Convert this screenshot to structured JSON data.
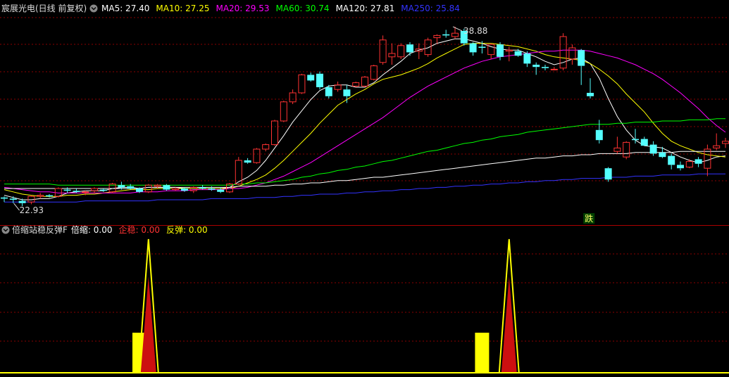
{
  "header": {
    "title": "宸展光电(日线 前复权)",
    "ma_items": [
      {
        "label": "MA5: 27.40",
        "color": "#ffffff"
      },
      {
        "label": "MA10: 27.25",
        "color": "#ffff00"
      },
      {
        "label": "MA20: 29.53",
        "color": "#ff00ff"
      },
      {
        "label": "MA60: 30.74",
        "color": "#00ff00"
      },
      {
        "label": "MA120: 27.81",
        "color": "#ffffff"
      },
      {
        "label": "MA250: 25.84",
        "color": "#3333ff"
      }
    ]
  },
  "indicator_header": {
    "title": "倍缩站稳反弹F",
    "items": [
      {
        "label": "倍缩: 0.00",
        "color": "#ffffff"
      },
      {
        "label": "企稳: 0.00",
        "color": "#ff3333"
      },
      {
        "label": "反弹: 0.00",
        "color": "#ffff00"
      }
    ]
  },
  "annotations": {
    "high_label": "38.88",
    "low_label": "22.93",
    "signal_label": "跌"
  },
  "colors": {
    "up": "#ff3232",
    "down": "#54ffff",
    "grid": "#8b0000",
    "background": "#000000"
  },
  "chart_data": {
    "type": "candlestick",
    "high_mark": 38.88,
    "low_mark": 22.93,
    "candles": [
      [
        23.7,
        23.8,
        23.3,
        23.6
      ],
      [
        23.6,
        23.8,
        23.2,
        23.5
      ],
      [
        23.4,
        23.6,
        22.93,
        23.2
      ],
      [
        23.3,
        23.9,
        23.1,
        23.8
      ],
      [
        23.8,
        24.1,
        23.6,
        23.9
      ],
      [
        23.9,
        24.0,
        23.7,
        23.8
      ],
      [
        23.8,
        24.6,
        23.7,
        24.5
      ],
      [
        24.4,
        24.6,
        24.1,
        24.3
      ],
      [
        24.3,
        24.5,
        24.1,
        24.2
      ],
      [
        24.2,
        24.3,
        23.9,
        24.2
      ],
      [
        24.3,
        24.6,
        24.1,
        24.5
      ],
      [
        24.4,
        24.5,
        24.2,
        24.3
      ],
      [
        24.2,
        25.0,
        24.1,
        24.9
      ],
      [
        24.8,
        25.1,
        24.4,
        24.6
      ],
      [
        24.7,
        24.9,
        24.4,
        24.5
      ],
      [
        24.5,
        24.6,
        24.1,
        24.2
      ],
      [
        24.2,
        24.9,
        24.1,
        24.8
      ],
      [
        24.7,
        24.9,
        24.5,
        24.8
      ],
      [
        24.8,
        24.9,
        24.3,
        24.4
      ],
      [
        24.4,
        24.6,
        24.3,
        24.5
      ],
      [
        24.5,
        24.6,
        24.2,
        24.3
      ],
      [
        24.3,
        24.7,
        24.1,
        24.6
      ],
      [
        24.6,
        24.8,
        24.4,
        24.5
      ],
      [
        24.5,
        24.7,
        24.3,
        24.4
      ],
      [
        24.4,
        24.6,
        24.1,
        24.2
      ],
      [
        24.2,
        25.0,
        24.1,
        24.9
      ],
      [
        24.9,
        27.3,
        24.8,
        27.0
      ],
      [
        27.0,
        27.2,
        26.7,
        26.8
      ],
      [
        26.8,
        28.1,
        26.7,
        28.0
      ],
      [
        28.0,
        28.5,
        27.8,
        28.4
      ],
      [
        28.4,
        30.6,
        28.3,
        30.5
      ],
      [
        30.5,
        32.3,
        30.4,
        32.2
      ],
      [
        32.2,
        33.3,
        32.0,
        33.0
      ],
      [
        33.0,
        34.7,
        32.9,
        34.6
      ],
      [
        34.6,
        34.8,
        34.0,
        34.1
      ],
      [
        34.7,
        34.9,
        33.3,
        33.5
      ],
      [
        33.5,
        33.7,
        32.5,
        32.7
      ],
      [
        33.3,
        34.0,
        33.1,
        33.7
      ],
      [
        33.3,
        33.7,
        32.1,
        32.7
      ],
      [
        33.6,
        34.0,
        33.5,
        33.9
      ],
      [
        33.6,
        34.5,
        33.5,
        34.4
      ],
      [
        34.2,
        35.5,
        34.1,
        35.4
      ],
      [
        35.7,
        38.1,
        35.5,
        37.7
      ],
      [
        36.2,
        37.4,
        35.5,
        36.5
      ],
      [
        36.2,
        37.4,
        36.0,
        37.2
      ],
      [
        37.3,
        37.5,
        36.3,
        36.6
      ],
      [
        36.7,
        37.4,
        36.0,
        36.9
      ],
      [
        36.4,
        37.9,
        36.2,
        37.7
      ],
      [
        37.9,
        38.2,
        37.4,
        38.1
      ],
      [
        38.2,
        38.6,
        37.9,
        38.1
      ],
      [
        38.0,
        38.88,
        37.8,
        38.3
      ],
      [
        38.5,
        38.7,
        37.2,
        37.4
      ],
      [
        37.4,
        37.5,
        36.3,
        36.6
      ],
      [
        37.1,
        37.6,
        36.5,
        37.0
      ],
      [
        36.4,
        37.4,
        36.0,
        37.3
      ],
      [
        37.3,
        37.5,
        35.9,
        36.2
      ],
      [
        36.7,
        37.1,
        35.8,
        36.8
      ],
      [
        36.7,
        36.9,
        36.2,
        36.3
      ],
      [
        36.5,
        36.7,
        35.3,
        35.6
      ],
      [
        35.5,
        35.7,
        34.6,
        35.3
      ],
      [
        35.3,
        35.5,
        35.0,
        35.2
      ],
      [
        35.1,
        35.3,
        35.0,
        35.1
      ],
      [
        35.2,
        38.3,
        35.0,
        38.0
      ],
      [
        36.0,
        37.3,
        35.5,
        37.0
      ],
      [
        36.8,
        36.9,
        33.7,
        35.4
      ],
      [
        33.0,
        34.3,
        32.5,
        32.7
      ],
      [
        29.7,
        30.6,
        28.5,
        28.8
      ],
      [
        26.3,
        26.4,
        25.1,
        25.3
      ],
      [
        27.8,
        29.1,
        27.6,
        28.1
      ],
      [
        27.3,
        28.7,
        27.1,
        28.6
      ],
      [
        28.9,
        29.8,
        28.5,
        28.8
      ],
      [
        28.9,
        29.1,
        28.3,
        28.3
      ],
      [
        28.4,
        28.7,
        27.4,
        27.6
      ],
      [
        27.7,
        28.2,
        27.2,
        27.3
      ],
      [
        27.4,
        27.6,
        26.2,
        26.6
      ],
      [
        26.6,
        26.9,
        26.1,
        26.3
      ],
      [
        26.4,
        27.1,
        26.3,
        26.9
      ],
      [
        27.1,
        27.3,
        26.4,
        26.7
      ],
      [
        26.3,
        28.4,
        25.6,
        28.0
      ],
      [
        28.1,
        29.4,
        27.9,
        28.3
      ],
      [
        28.5,
        29.0,
        28.1,
        28.7
      ]
    ],
    "series": [
      {
        "name": "MA5",
        "color": "#ffffff",
        "values": [
          23.9,
          23.7,
          23.5,
          23.5,
          23.6,
          23.6,
          23.8,
          24.1,
          24.2,
          24.3,
          24.3,
          24.3,
          24.5,
          24.6,
          24.6,
          24.5,
          24.6,
          24.6,
          24.6,
          24.6,
          24.5,
          24.5,
          24.5,
          24.5,
          24.5,
          24.6,
          25.1,
          25.5,
          26.1,
          27.0,
          28.1,
          29.2,
          30.4,
          31.4,
          32.4,
          33.2,
          33.6,
          33.7,
          33.7,
          33.5,
          33.5,
          33.9,
          34.6,
          35.2,
          35.8,
          36.5,
          36.8,
          37.0,
          37.4,
          37.6,
          37.8,
          37.8,
          37.6,
          37.4,
          37.1,
          36.9,
          36.8,
          36.8,
          36.5,
          36.2,
          35.8,
          35.5,
          35.7,
          36.0,
          36.1,
          35.6,
          34.3,
          32.5,
          30.9,
          29.7,
          28.8,
          28.3,
          28.2,
          28.1,
          27.7,
          27.3,
          27.0,
          26.8,
          27.0,
          27.3,
          27.4
        ]
      },
      {
        "name": "MA10",
        "color": "#ffff00",
        "values": [
          24.4,
          24.2,
          24.0,
          23.9,
          23.8,
          23.8,
          23.8,
          23.9,
          23.9,
          24.0,
          24.0,
          24.1,
          24.2,
          24.3,
          24.4,
          24.4,
          24.4,
          24.5,
          24.5,
          24.5,
          24.5,
          24.5,
          24.5,
          24.5,
          24.5,
          24.5,
          24.7,
          25.0,
          25.3,
          25.7,
          26.3,
          27.0,
          27.8,
          28.6,
          29.4,
          30.3,
          31.1,
          31.9,
          32.4,
          32.9,
          33.3,
          33.8,
          34.2,
          34.4,
          34.6,
          34.9,
          35.2,
          35.6,
          36.1,
          36.5,
          36.9,
          37.3,
          37.4,
          37.4,
          37.4,
          37.3,
          37.2,
          37.1,
          36.9,
          36.7,
          36.4,
          36.2,
          36.1,
          36.0,
          35.9,
          35.6,
          35.1,
          34.5,
          33.8,
          32.9,
          32.1,
          31.3,
          30.3,
          29.4,
          28.7,
          28.3,
          28.0,
          27.7,
          27.5,
          27.4,
          27.3
        ]
      },
      {
        "name": "MA20",
        "color": "#ff00ff",
        "values": [
          24.6,
          24.5,
          24.4,
          24.3,
          24.2,
          24.2,
          24.1,
          24.1,
          24.1,
          24.1,
          24.1,
          24.1,
          24.1,
          24.1,
          24.1,
          24.2,
          24.2,
          24.2,
          24.3,
          24.3,
          24.3,
          24.4,
          24.4,
          24.4,
          24.4,
          24.5,
          24.5,
          24.6,
          24.8,
          25.0,
          25.3,
          25.6,
          26.0,
          26.4,
          26.8,
          27.3,
          27.8,
          28.3,
          28.8,
          29.3,
          29.8,
          30.3,
          30.8,
          31.4,
          32.0,
          32.6,
          33.1,
          33.6,
          34.0,
          34.4,
          34.8,
          35.2,
          35.5,
          35.8,
          36.0,
          36.2,
          36.3,
          36.4,
          36.5,
          36.6,
          36.7,
          36.7,
          36.8,
          36.8,
          36.8,
          36.7,
          36.5,
          36.3,
          36.1,
          35.8,
          35.5,
          35.1,
          34.7,
          34.2,
          33.6,
          33.0,
          32.3,
          31.6,
          30.8,
          30.1,
          29.5
        ]
      },
      {
        "name": "MA60",
        "color": "#00ff00",
        "values": [
          24.9,
          24.9,
          24.9,
          24.9,
          24.9,
          24.9,
          24.8,
          24.8,
          24.8,
          24.8,
          24.8,
          24.8,
          24.8,
          24.8,
          24.8,
          24.8,
          24.8,
          24.8,
          24.8,
          24.8,
          24.8,
          24.8,
          24.8,
          24.8,
          24.8,
          24.8,
          24.9,
          24.9,
          25.0,
          25.0,
          25.1,
          25.2,
          25.3,
          25.5,
          25.6,
          25.8,
          25.9,
          26.1,
          26.2,
          26.4,
          26.5,
          26.7,
          26.9,
          27.0,
          27.2,
          27.4,
          27.6,
          27.8,
          27.9,
          28.1,
          28.3,
          28.5,
          28.6,
          28.8,
          28.9,
          29.1,
          29.2,
          29.3,
          29.5,
          29.6,
          29.7,
          29.8,
          29.9,
          30.0,
          30.1,
          30.2,
          30.2,
          30.2,
          30.3,
          30.3,
          30.4,
          30.4,
          30.4,
          30.5,
          30.5,
          30.5,
          30.6,
          30.6,
          30.6,
          30.7,
          30.7
        ]
      },
      {
        "name": "MA120",
        "color": "#ffffff",
        "values": [
          24.5,
          24.5,
          24.5,
          24.5,
          24.5,
          24.5,
          24.5,
          24.5,
          24.5,
          24.5,
          24.5,
          24.5,
          24.5,
          24.5,
          24.5,
          24.5,
          24.6,
          24.6,
          24.6,
          24.6,
          24.6,
          24.6,
          24.6,
          24.6,
          24.6,
          24.6,
          24.7,
          24.7,
          24.7,
          24.7,
          24.8,
          24.8,
          24.9,
          24.9,
          25.0,
          25.0,
          25.1,
          25.2,
          25.2,
          25.3,
          25.4,
          25.5,
          25.5,
          25.6,
          25.7,
          25.8,
          25.9,
          26.0,
          26.1,
          26.2,
          26.3,
          26.4,
          26.5,
          26.6,
          26.7,
          26.8,
          26.9,
          27.0,
          27.1,
          27.2,
          27.2,
          27.3,
          27.4,
          27.4,
          27.5,
          27.5,
          27.6,
          27.6,
          27.6,
          27.6,
          27.7,
          27.7,
          27.7,
          27.7,
          27.7,
          27.8,
          27.8,
          27.8,
          27.8,
          27.8,
          27.8
        ]
      },
      {
        "name": "MA250",
        "color": "#3333ff",
        "values": [
          23.3,
          23.3,
          23.3,
          23.3,
          23.3,
          23.3,
          23.3,
          23.3,
          23.3,
          23.4,
          23.4,
          23.4,
          23.4,
          23.4,
          23.4,
          23.4,
          23.4,
          23.5,
          23.5,
          23.5,
          23.5,
          23.5,
          23.5,
          23.6,
          23.6,
          23.6,
          23.6,
          23.6,
          23.7,
          23.7,
          23.7,
          23.8,
          23.8,
          23.9,
          23.9,
          24.0,
          24.0,
          24.0,
          24.1,
          24.1,
          24.2,
          24.2,
          24.3,
          24.3,
          24.4,
          24.4,
          24.5,
          24.5,
          24.6,
          24.6,
          24.7,
          24.7,
          24.8,
          24.8,
          24.9,
          24.9,
          25.0,
          25.0,
          25.1,
          25.1,
          25.2,
          25.2,
          25.3,
          25.3,
          25.4,
          25.4,
          25.4,
          25.5,
          25.5,
          25.5,
          25.6,
          25.6,
          25.6,
          25.7,
          25.7,
          25.7,
          25.7,
          25.8,
          25.8,
          25.8,
          25.8
        ]
      }
    ],
    "indicator": {
      "yellow_bars": [
        {
          "index": 15,
          "value": 0.3
        },
        {
          "index": 53,
          "value": 0.3
        }
      ],
      "spikes": [
        {
          "index": 16,
          "yellow": 1.0,
          "red": 0.72
        },
        {
          "index": 56,
          "yellow": 1.0,
          "red": 0.72
        }
      ]
    }
  }
}
